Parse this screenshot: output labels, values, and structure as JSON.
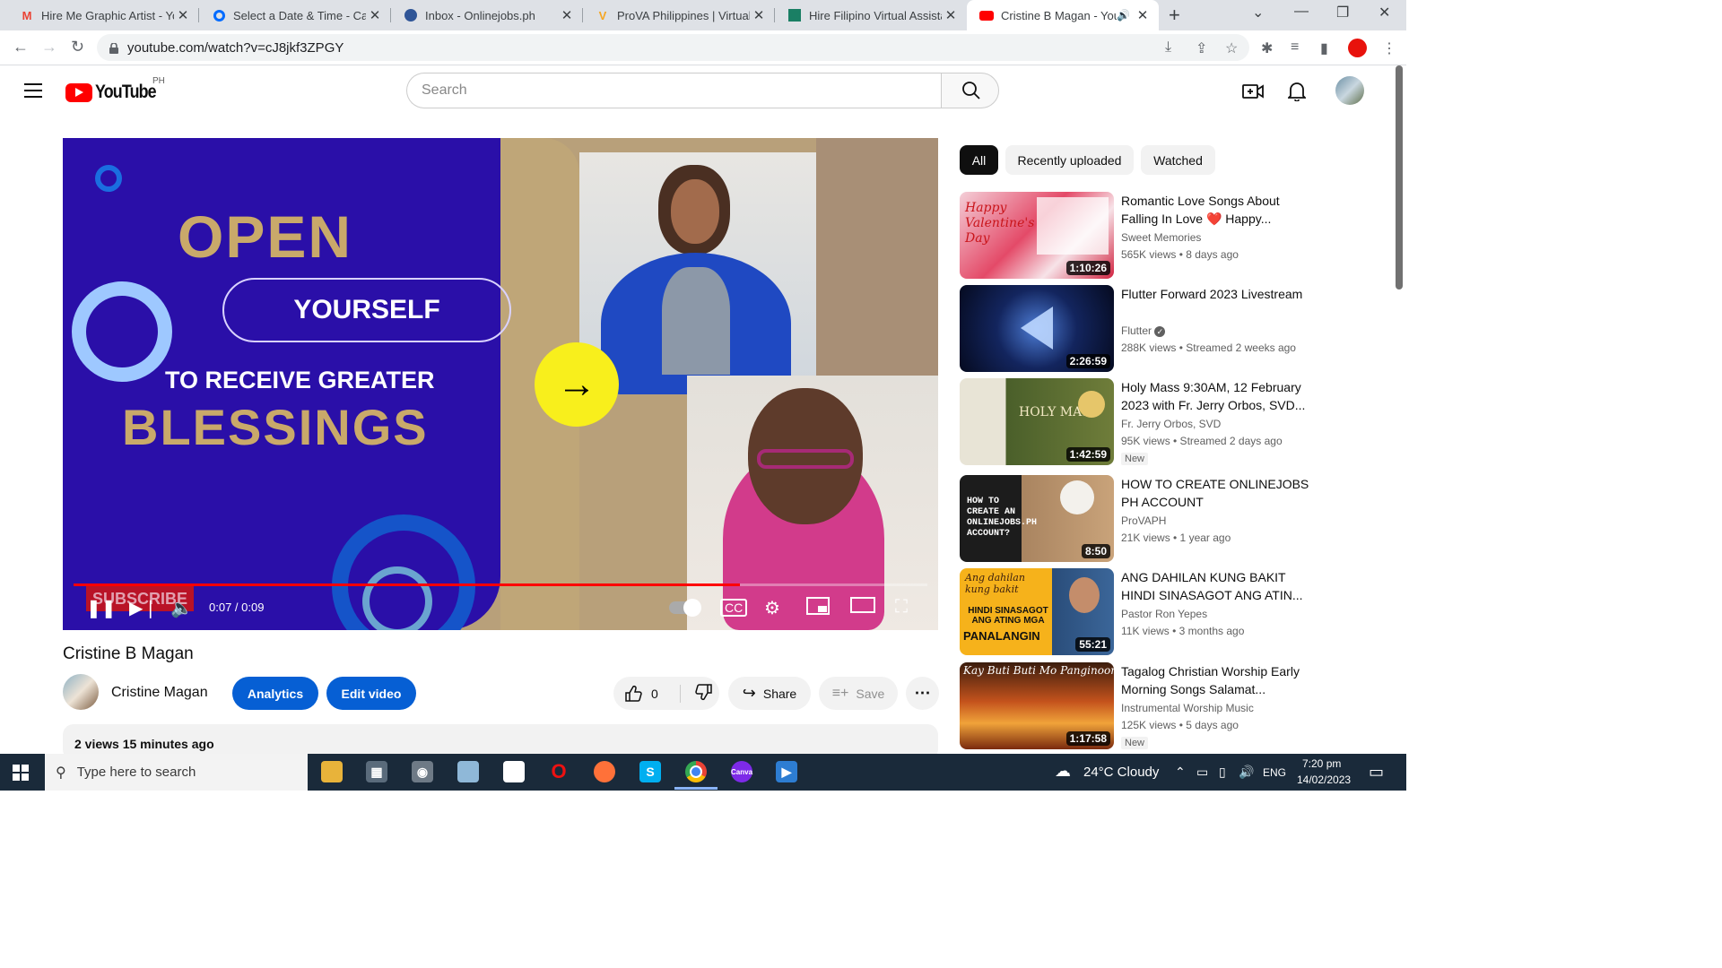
{
  "browser": {
    "tabs": [
      {
        "title": "Hire Me Graphic Artist - Yo",
        "favicon": "gmail-icon",
        "color": "#ea4335"
      },
      {
        "title": "Select a Date & Time - Cale",
        "favicon": "calendly-icon",
        "color": "#006bff"
      },
      {
        "title": "Inbox - Onlinejobs.ph",
        "favicon": "globe-icon",
        "color": "#2f5597"
      },
      {
        "title": "ProVA Philippines | Virtual A",
        "favicon": "prova-icon",
        "color": "#f5a623"
      },
      {
        "title": "Hire Filipino Virtual Assistar",
        "favicon": "bookmark-icon",
        "color": "#1a7f64"
      },
      {
        "title": "Cristine B Magan - You",
        "favicon": "youtube-icon",
        "color": "#ff0000",
        "active": true
      }
    ],
    "url": "youtube.com/watch?v=cJ8jkf3ZPGY"
  },
  "youtube": {
    "logo_text": "YouTube",
    "country_code": "PH",
    "search_placeholder": "Search"
  },
  "video": {
    "thumbnail_text": {
      "open": "OPEN",
      "yourself": "YOURSELF",
      "receive": "TO RECEIVE GREATER",
      "blessings": "BLESSINGS",
      "subscribe": "SUBSCRIBE"
    },
    "time": "0:07 / 0:09",
    "progress": 0.78,
    "title": "Cristine B Magan",
    "channel": "Cristine Magan",
    "analytics_label": "Analytics",
    "edit_label": "Edit video",
    "likes": "0",
    "share_label": "Share",
    "save_label": "Save",
    "views_time": "2 views  15 minutes ago"
  },
  "chips": [
    "All",
    "Recently uploaded",
    "Watched"
  ],
  "recommendations": [
    {
      "title": "Romantic Love Songs About Falling In Love ❤️ Happy...",
      "channel": "Sweet Memories",
      "meta": "565K views • 8 days ago",
      "duration": "1:10:26",
      "new": "",
      "verified": false
    },
    {
      "title": "Flutter Forward 2023 Livestream",
      "channel": "Flutter",
      "meta": "288K views • Streamed 2 weeks ago",
      "duration": "2:26:59",
      "new": "",
      "verified": true
    },
    {
      "title": "Holy Mass 9:30AM, 12 February 2023 with Fr. Jerry Orbos, SVD...",
      "channel": "Fr. Jerry Orbos, SVD",
      "meta": "95K views • Streamed 2 days ago",
      "duration": "1:42:59",
      "new": "New",
      "verified": false
    },
    {
      "title": "HOW TO CREATE ONLINEJOBS PH ACCOUNT",
      "channel": "ProVAPH",
      "meta": "21K views • 1 year ago",
      "duration": "8:50",
      "new": "",
      "verified": false
    },
    {
      "title": "ANG DAHILAN KUNG BAKIT HINDI SINASAGOT ANG ATIN...",
      "channel": "Pastor Ron Yepes",
      "meta": "11K views • 3 months ago",
      "duration": "55:21",
      "new": "",
      "verified": false
    },
    {
      "title": "Tagalog Christian Worship Early Morning Songs Salamat...",
      "channel": "Instrumental Worship Music",
      "meta": "125K views • 5 days ago",
      "duration": "1:17:58",
      "new": "New",
      "verified": false
    }
  ],
  "thumb_text": {
    "valentine": "Happy Valentine's Day",
    "holymass": "HOLY MASS",
    "onlinejobs": "HOW TO CREATE AN ONLINEJOBS.PH ACCOUNT?",
    "dahilan_top": "Ang dahilan kung bakit",
    "dahilan_mid": "HINDI SINASAGOT ANG ATING MGA",
    "dahilan_bottom": "PANALANGIN",
    "worship": "Kay Buti Buti Mo Panginoon"
  },
  "taskbar": {
    "search_placeholder": "Type here to search",
    "weather": "24°C  Cloudy",
    "language": "ENG",
    "time": "7:20 pm",
    "date": "14/02/2023"
  }
}
